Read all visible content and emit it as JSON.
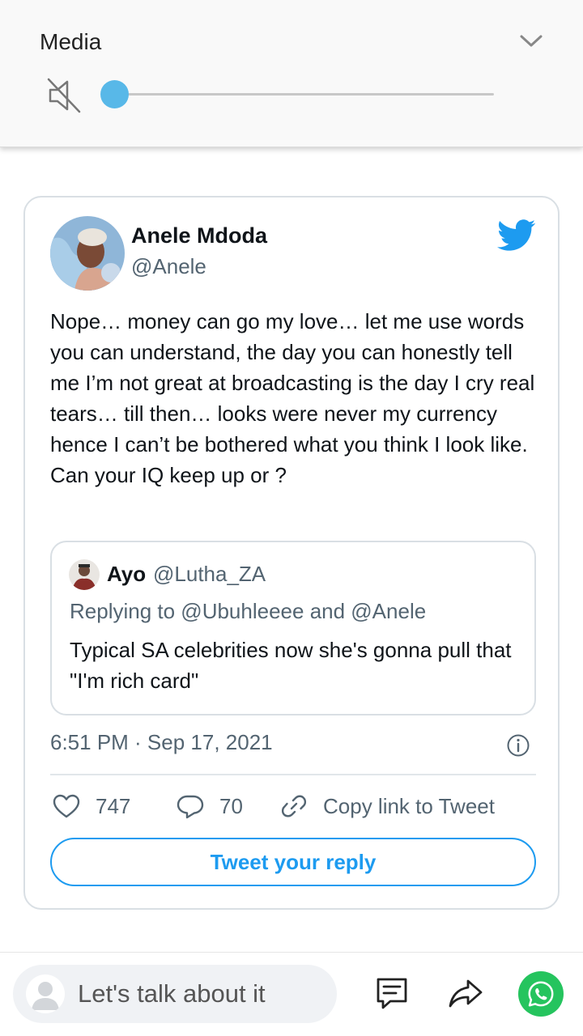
{
  "media_panel": {
    "title": "Media",
    "volume_level": 0
  },
  "tweet": {
    "author_name": "Anele Mdoda",
    "author_handle": "@Anele",
    "text": "Nope… money can go my love… let me use words you can understand, the day you can honestly tell me I’m not great at broadcasting is the day I cry real tears… till then… looks were never my currency hence I can’t be bothered what you think I look like. Can your IQ keep up or ?",
    "quoted": {
      "author_name": "Ayo",
      "author_handle": "@Lutha_ZA",
      "replying_to": "Replying to @Ubuhleeee and @Anele",
      "text": "Typical SA celebrities now she's gonna pull that \"I'm rich card\""
    },
    "timestamp": "6:51 PM · Sep 17, 2021",
    "likes": "747",
    "replies": "70",
    "copy_link_label": "Copy link to Tweet",
    "reply_button_label": "Tweet your reply",
    "brand_color": "#1d9bf0"
  },
  "comment_bar": {
    "placeholder": "Let's talk about it",
    "whatsapp_color": "#25c45e"
  }
}
